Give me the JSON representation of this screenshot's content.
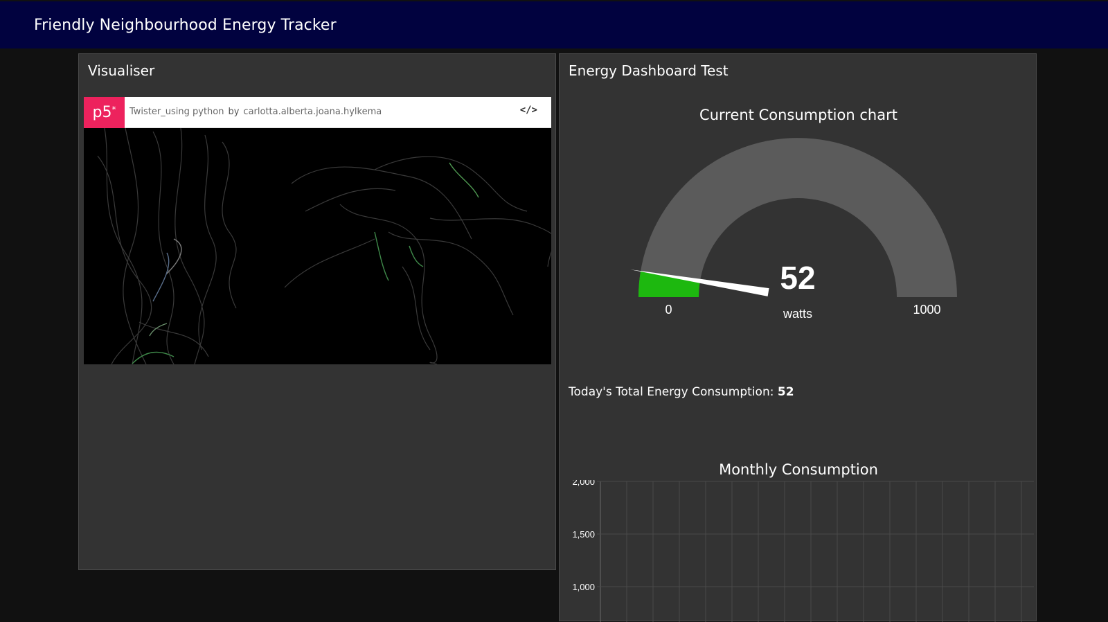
{
  "header": {
    "title": "Friendly Neighbourhood Energy Tracker"
  },
  "visualiser": {
    "title": "Visualiser",
    "embed": {
      "logo": "p5",
      "logo_mark": "*",
      "sketch_name": "Twister_using python",
      "by_label": "by",
      "author": "carlotta.alberta.joana.hylkema",
      "code_icon": "</>"
    }
  },
  "dashboard": {
    "title": "Energy Dashboard Test",
    "gauge": {
      "title": "Current Consumption chart",
      "value": 52,
      "value_label": "52",
      "unit": "watts",
      "min": 0,
      "max": 1000,
      "min_label": "0",
      "max_label": "1000",
      "fill_color": "#1db80f",
      "track_color": "#5b5b5b"
    },
    "total": {
      "label": "Today's Total Energy Consumption:",
      "value": "52"
    },
    "monthly": {
      "title": "Monthly Consumption"
    }
  },
  "chart_data": {
    "type": "bar",
    "title": "Monthly Consumption",
    "categories": [],
    "values": [],
    "ylim": [
      0,
      2000
    ],
    "visible_y_ticks": [
      "2,000",
      "1,500",
      "1,000"
    ],
    "grid": true
  }
}
